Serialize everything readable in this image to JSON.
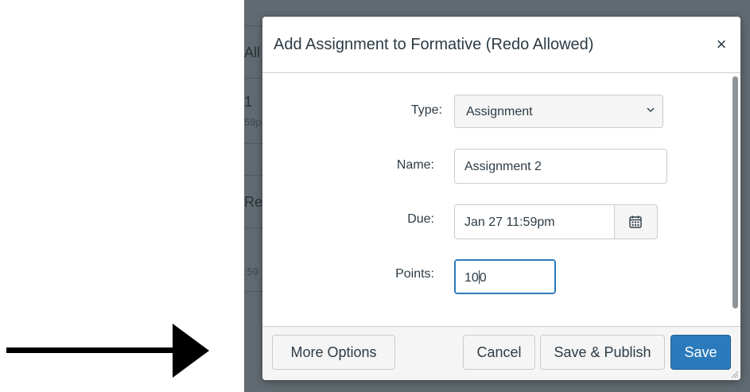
{
  "background": {
    "fragments": [
      "All",
      "1",
      "59p",
      "Red",
      ":59"
    ]
  },
  "dialog": {
    "title": "Add Assignment to Formative (Redo Allowed)",
    "close_glyph": "×",
    "fields": {
      "type": {
        "label": "Type:",
        "value": "Assignment",
        "options_visible": [
          "Assignment"
        ]
      },
      "name": {
        "label": "Name:",
        "value": "Assignment 2"
      },
      "due": {
        "label": "Due:",
        "value": "Jan 27 11:59pm",
        "calendar_icon": "calendar-icon"
      },
      "points": {
        "label": "Points:",
        "value_before_caret": "10",
        "value_after_caret": "0",
        "value": "100"
      }
    },
    "footer": {
      "more_options": "More Options",
      "cancel": "Cancel",
      "save_publish": "Save & Publish",
      "save": "Save"
    }
  },
  "colors": {
    "primary": "#2b7abc",
    "backdrop": "#606a70",
    "border": "#c7cdd1",
    "text": "#2d3b45"
  },
  "annotation": {
    "arrow_color": "#000000"
  }
}
